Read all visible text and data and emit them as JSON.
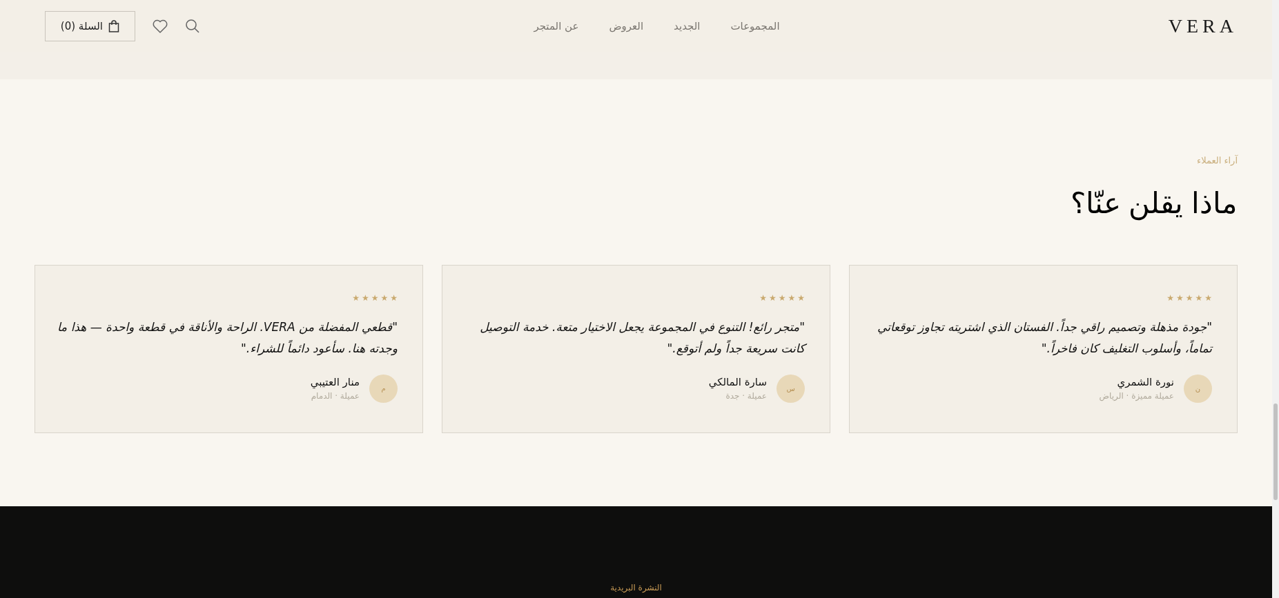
{
  "header": {
    "logo": "VERA",
    "nav": [
      {
        "label": "المجموعات"
      },
      {
        "label": "الجديد"
      },
      {
        "label": "العروض"
      },
      {
        "label": "عن المتجر"
      }
    ],
    "cart": {
      "label": "السلة (0)"
    }
  },
  "testimonials": {
    "eyebrow": "آراء العملاء",
    "title": "ماذا يقلن عنّا؟",
    "cards": [
      {
        "stars": 5,
        "quote": "\"جودة مذهلة وتصميم راقي جداً. الفستان الذي اشتريته تجاوز توقعاتي تماماً، وأسلوب التغليف كان فاخراً.\"",
        "initial": "ن",
        "name": "نورة الشمري",
        "meta": "عميلة مميزة · الرياض"
      },
      {
        "stars": 5,
        "quote": "\"متجر رائع! التنوع في المجموعة يجعل الاختيار متعة. خدمة التوصيل كانت سريعة جداً ولم أتوقع.\"",
        "initial": "س",
        "name": "سارة المالكي",
        "meta": "عميلة · جدة"
      },
      {
        "stars": 5,
        "quote": "\"قطعي المفضلة من VERA. الراحة والأناقة في قطعة واحدة — هذا ما وجدته هنا. سأعود دائماً للشراء.\"",
        "initial": "م",
        "name": "منار العتيبي",
        "meta": "عميلة · الدمام"
      }
    ]
  },
  "footer": {
    "label": "النشرة البريدية"
  }
}
